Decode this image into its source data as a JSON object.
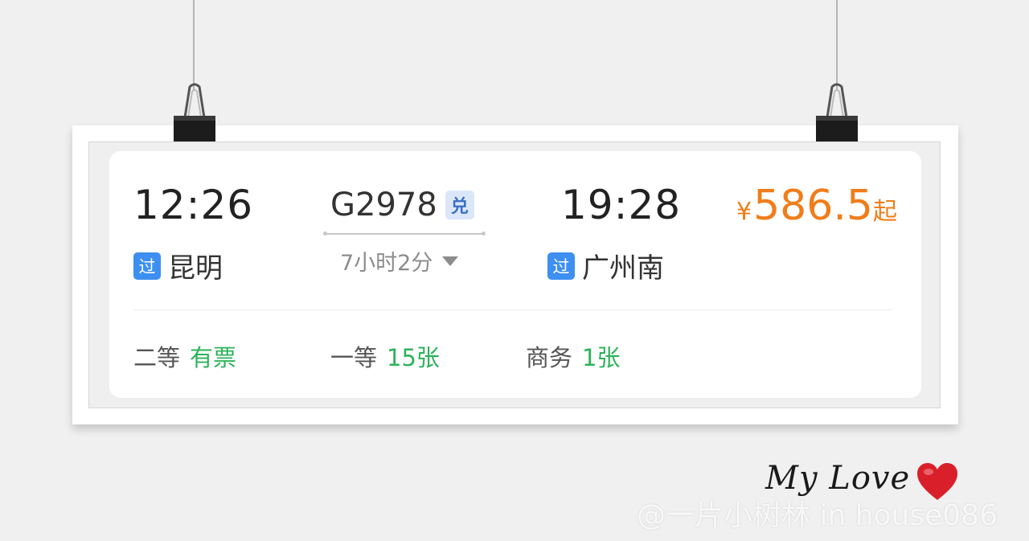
{
  "ticket": {
    "departure": {
      "time": "12:26",
      "station": "昆明",
      "badge": "过"
    },
    "arrival": {
      "time": "19:28",
      "station": "广州南",
      "badge": "过"
    },
    "train": {
      "number": "G2978",
      "badge": "兑"
    },
    "duration": "7小时2分",
    "price": {
      "currency": "¥",
      "amount": "586.5",
      "suffix": "起"
    },
    "seats": [
      {
        "class": "二等",
        "availability": "有票"
      },
      {
        "class": "一等",
        "availability": "15张"
      },
      {
        "class": "商务",
        "availability": "1张"
      }
    ]
  },
  "decoration": {
    "caption": "My Love",
    "watermark": "@一片小树林 in house086",
    "icons": [
      "binder-clip-icon",
      "heart-icon",
      "chevron-down-icon"
    ]
  },
  "colors": {
    "price": "#f07d1a",
    "available": "#2cb35a",
    "badge": "#3d8ff2",
    "exchange_badge_bg": "#dbe7f9",
    "heart": "#d9202a"
  }
}
